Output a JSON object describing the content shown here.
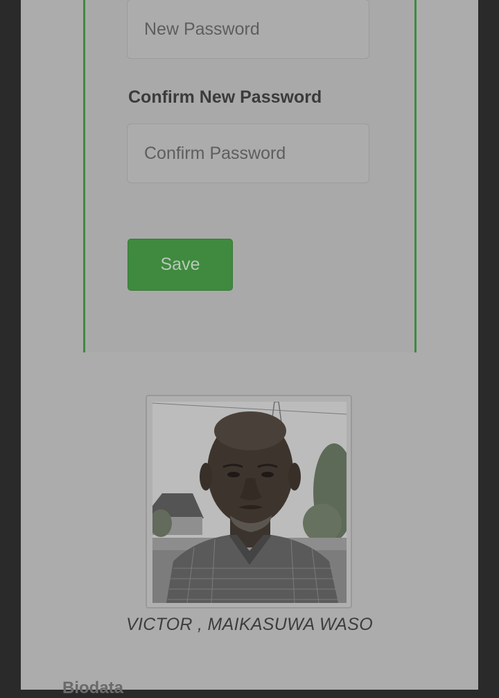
{
  "form": {
    "new_password_placeholder": "New Password",
    "confirm_label": "Confirm New Password",
    "confirm_password_placeholder": "Confirm Password",
    "save_label": "Save"
  },
  "profile": {
    "name": "VICTOR , MAIKASUWA WASO",
    "photo_alt": "profile-photo"
  },
  "sections": {
    "biodata_heading": "Biodata"
  },
  "colors": {
    "accent": "#3f8a3f",
    "background": "#acacac",
    "frame": "#2a2a2a"
  }
}
